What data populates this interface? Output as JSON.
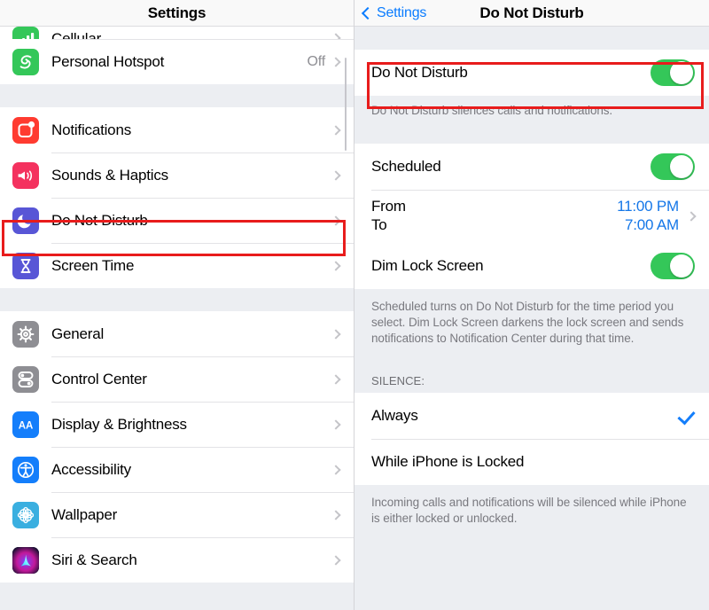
{
  "left_panel": {
    "nav": {
      "title": "Settings"
    },
    "groups": [
      {
        "rows": [
          {
            "label": "Cellular",
            "icon": "cellular-icon",
            "value": "",
            "clipped": true
          },
          {
            "label": "Personal Hotspot",
            "icon": "hotspot-icon",
            "value": "Off",
            "clipped": false
          }
        ]
      },
      {
        "rows": [
          {
            "label": "Notifications",
            "icon": "notifications-icon",
            "value": "",
            "clipped": false
          },
          {
            "label": "Sounds & Haptics",
            "icon": "sounds-icon",
            "value": "",
            "clipped": false
          },
          {
            "label": "Do Not Disturb",
            "icon": "do-not-disturb-icon",
            "value": "",
            "clipped": false
          },
          {
            "label": "Screen Time",
            "icon": "screen-time-icon",
            "value": "",
            "clipped": false
          }
        ]
      },
      {
        "rows": [
          {
            "label": "General",
            "icon": "general-icon",
            "value": "",
            "clipped": false
          },
          {
            "label": "Control Center",
            "icon": "control-center-icon",
            "value": "",
            "clipped": false
          },
          {
            "label": "Display & Brightness",
            "icon": "display-brightness-icon",
            "value": "",
            "clipped": false
          },
          {
            "label": "Accessibility",
            "icon": "accessibility-icon",
            "value": "",
            "clipped": false
          },
          {
            "label": "Wallpaper",
            "icon": "wallpaper-icon",
            "value": "",
            "clipped": false
          },
          {
            "label": "Siri & Search",
            "icon": "siri-search-icon",
            "value": "",
            "clipped": false
          }
        ]
      }
    ]
  },
  "right_panel": {
    "nav": {
      "back_label": "Settings",
      "title": "Do Not Disturb"
    },
    "dnd_row": {
      "label": "Do Not Disturb",
      "toggle_on": true
    },
    "dnd_note": "Do Not Disturb silences calls and notifications.",
    "scheduled_row": {
      "label": "Scheduled",
      "toggle_on": true
    },
    "from_to_row": {
      "from_label": "From",
      "to_label": "To",
      "from_value": "11:00 PM",
      "to_value": "7:00 AM"
    },
    "dim_lock_row": {
      "label": "Dim Lock Screen",
      "toggle_on": true
    },
    "schedule_note": "Scheduled turns on Do Not Disturb for the time period you select. Dim Lock Screen darkens the lock screen and sends notifications to Notification Center during that time.",
    "silence_header": "SILENCE:",
    "silence_options": [
      {
        "label": "Always",
        "selected": true
      },
      {
        "label": "While iPhone is Locked",
        "selected": false
      }
    ],
    "silence_note": "Incoming calls and notifications will be silenced while iPhone is either locked or unlocked."
  },
  "colors": {
    "accent_blue": "#147efb",
    "toggle_green": "#34c759",
    "highlight_red": "#e81c1c",
    "group_bg": "#eceef2"
  }
}
